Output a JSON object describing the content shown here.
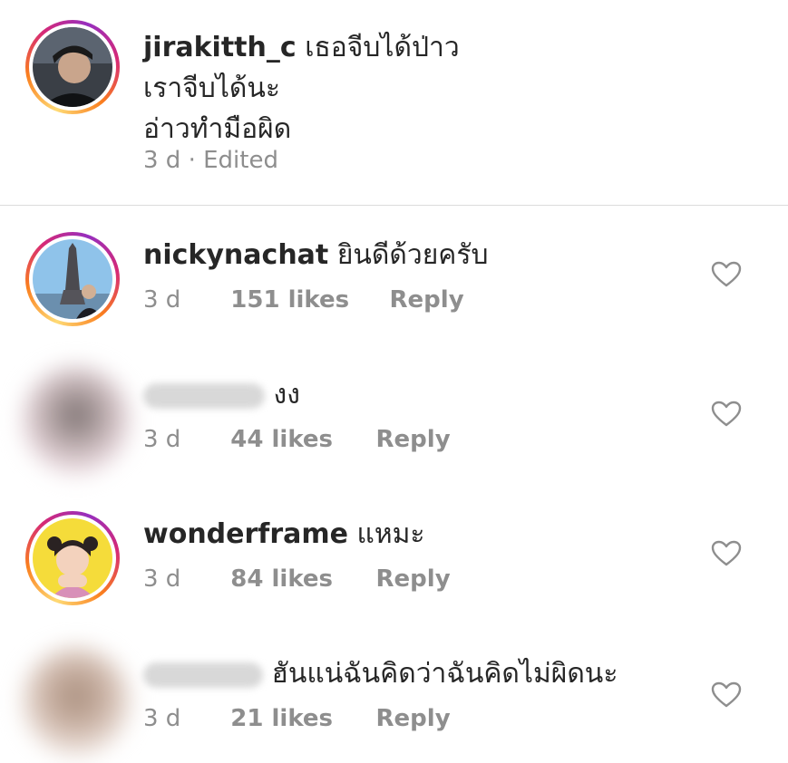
{
  "caption": {
    "username": "jirakitth_c",
    "lines": [
      "เธอจีบได้ป่าว",
      "เราจีบได้นะ",
      "อ่าวทำมือผิด"
    ],
    "time": "3 d",
    "separator": "·",
    "edited": "Edited"
  },
  "comments": [
    {
      "username": "nickynachat",
      "text": "ยินดีด้วยครับ",
      "time": "3 d",
      "likes": "151 likes",
      "reply": "Reply",
      "liked": false
    },
    {
      "username": "",
      "text": "งง",
      "time": "3 d",
      "likes": "44 likes",
      "reply": "Reply",
      "liked": false
    },
    {
      "username": "wonderframe",
      "text": "แหมะ",
      "time": "3 d",
      "likes": "84 likes",
      "reply": "Reply",
      "liked": false
    },
    {
      "username": "",
      "text": "ฮันแน่ฉันคิดว่าฉันคิดไม่ผิดนะ",
      "time": "3 d",
      "likes": "21 likes",
      "reply": "Reply",
      "liked": false
    }
  ],
  "icons": {
    "like": "heart-outline-icon"
  },
  "colors": {
    "text": "#262626",
    "meta": "#8e8e8e",
    "divider": "#dbdbdb"
  }
}
